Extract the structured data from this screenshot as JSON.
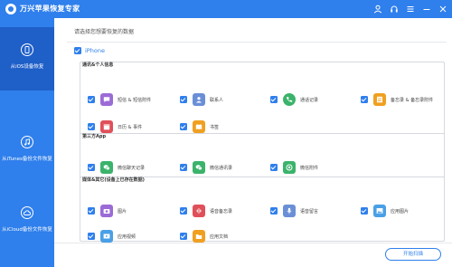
{
  "app": {
    "title": "万兴苹果恢复专家"
  },
  "titlebar": {
    "icons": [
      "user-icon",
      "headset-icon",
      "menu-icon",
      "minimize-icon",
      "close-icon"
    ]
  },
  "sidebar": {
    "items": [
      {
        "label": "从iOS设备恢复",
        "icon": "phone-icon",
        "active": true
      },
      {
        "label": "从iTunes备份文件恢复",
        "icon": "music-note-icon",
        "active": false
      },
      {
        "label": "从iCloud备份文件恢复",
        "icon": "cloud-icon",
        "active": false
      }
    ]
  },
  "main": {
    "prompt": "请选择您想要恢复的数据",
    "iphone_label": "iPhone",
    "groups": [
      {
        "title": "通讯&个人信息",
        "items": [
          {
            "label": "短信 & 短信附件",
            "icon": "message-icon",
            "color": "#9b6bd6"
          },
          {
            "label": "联系人",
            "icon": "contacts-icon",
            "color": "#6b8fd6"
          },
          {
            "label": "通话记录",
            "icon": "phone-call-icon",
            "color": "#3bb36b"
          },
          {
            "label": "备忘录 & 备忘录附件",
            "icon": "notes-icon",
            "color": "#f0a020"
          },
          {
            "label": "日历 & 事件",
            "icon": "calendar-icon",
            "color": "#e0505a"
          },
          {
            "label": "书签",
            "icon": "bookmark-icon",
            "color": "#f0a020"
          }
        ]
      },
      {
        "title": "第三方App",
        "items": [
          {
            "label": "微信聊天记录",
            "icon": "wechat-icon",
            "color": "#3bb36b"
          },
          {
            "label": "微信通讯录",
            "icon": "wechat-contacts-icon",
            "color": "#3bb36b"
          },
          {
            "label": "微信附件",
            "icon": "wechat-attachment-icon",
            "color": "#3bb36b"
          }
        ]
      },
      {
        "title": "媒体&其它(设备上已存在数据)",
        "items": [
          {
            "label": "图片",
            "icon": "camera-icon",
            "color": "#9b6bd6"
          },
          {
            "label": "语音备忘录",
            "icon": "voice-memo-icon",
            "color": "#e0505a"
          },
          {
            "label": "语音留言",
            "icon": "voicemail-icon",
            "color": "#6b8fd6"
          },
          {
            "label": "应用图片",
            "icon": "app-photo-icon",
            "color": "#4aa0e6"
          },
          {
            "label": "应用视频",
            "icon": "app-video-icon",
            "color": "#4aa0e6"
          },
          {
            "label": "应用文档",
            "icon": "app-document-icon",
            "color": "#f0a020"
          }
        ]
      }
    ],
    "start_button": "开始扫描"
  }
}
